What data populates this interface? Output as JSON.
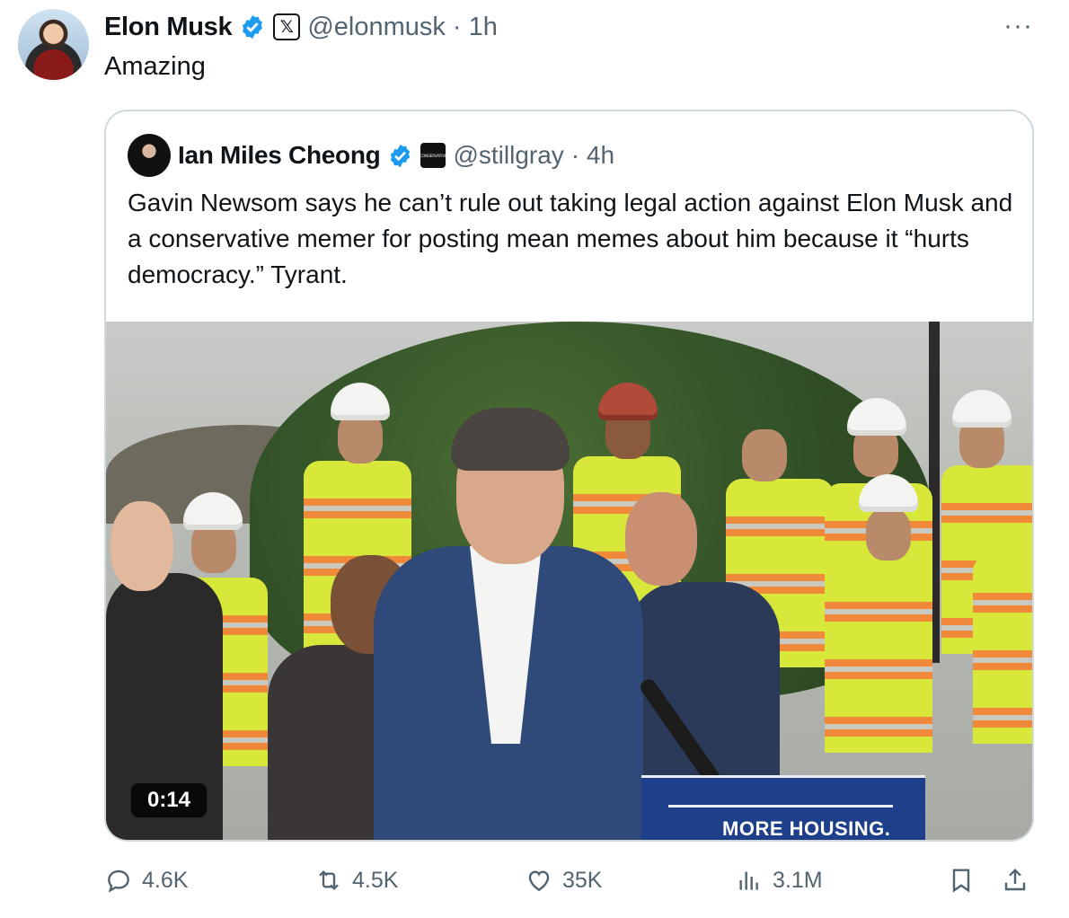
{
  "post": {
    "author_name": "Elon Musk",
    "author_handle": "@elonmusk",
    "time": "· 1h",
    "text": "Amazing",
    "more": "···"
  },
  "quoted": {
    "author_name": "Ian Miles Cheong",
    "author_handle": "@stillgray",
    "time": "· 4h",
    "badge_text": "CONSERVATIVE",
    "text": "Gavin Newsom says he can’t rule out taking legal action against Elon Musk and a conservative memer for posting mean memes about him because it “hurts democracy.” Tyrant.",
    "video": {
      "duration": "0:14",
      "podium_text": "MORE HOUSING."
    }
  },
  "actions": {
    "replies": "4.6K",
    "reposts": "4.5K",
    "likes": "35K",
    "views": "3.1M"
  },
  "colors": {
    "verified": "#1d9bf0",
    "muted": "#536471",
    "border": "#cfd9de"
  }
}
